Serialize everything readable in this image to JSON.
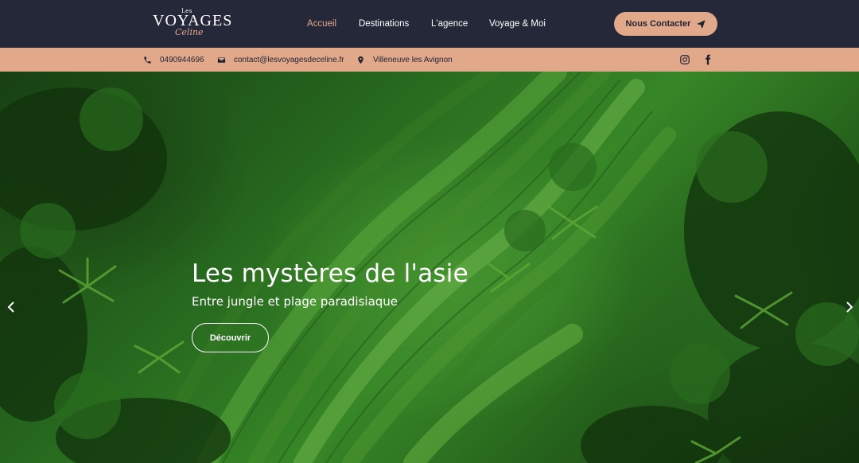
{
  "logo": {
    "les": "Les",
    "voyages": "VOYAGES",
    "celine": "Celine"
  },
  "nav": {
    "items": [
      {
        "label": "Accueil",
        "active": true
      },
      {
        "label": "Destinations",
        "active": false
      },
      {
        "label": "L'agence",
        "active": false
      },
      {
        "label": "Voyage & Moi",
        "active": false
      }
    ]
  },
  "header": {
    "contact_label": "Nous Contacter"
  },
  "infobar": {
    "phone": "0490944696",
    "email": "contact@lesvoyagesdeceline.fr",
    "location": "Villeneuve les Avignon"
  },
  "hero": {
    "title": "Les mystères de l'asie",
    "subtitle": "Entre jungle et plage paradisiaque",
    "cta": "Découvrir"
  },
  "colors": {
    "header_bg": "#252839",
    "accent": "#e1a88a",
    "text_dark": "#1f2233"
  },
  "icons": {
    "phone": "phone-icon",
    "email": "envelope-icon",
    "location": "map-pin-icon",
    "instagram": "instagram-icon",
    "facebook": "facebook-icon",
    "send": "paper-plane-icon",
    "prev": "chevron-left-icon",
    "next": "chevron-right-icon"
  }
}
